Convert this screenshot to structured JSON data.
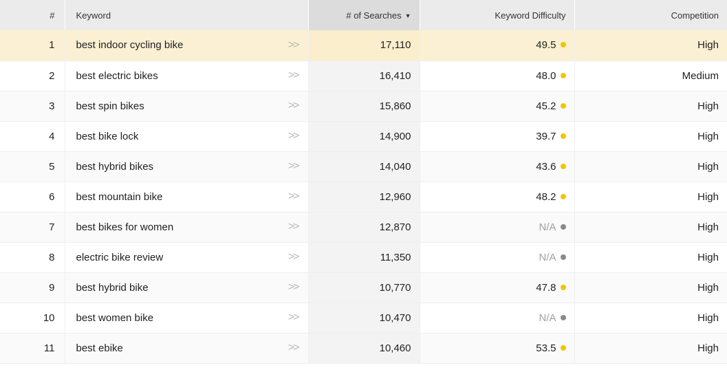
{
  "colors": {
    "difficulty_dot": "#f2c500",
    "na_dot": "#8a8a8a",
    "highlight_row": "#fbf0d3",
    "header_bg": "#ebebeb"
  },
  "header": {
    "num": "#",
    "keyword": "Keyword",
    "searches": "# of Searches",
    "searches_sort_icon": "caret-down-icon",
    "difficulty": "Keyword Difficulty",
    "competition": "Competition"
  },
  "rows": [
    {
      "num": "1",
      "keyword": "best indoor cycling bike",
      "searches": "17,110",
      "difficulty": "49.5",
      "competition": "High"
    },
    {
      "num": "2",
      "keyword": "best electric bikes",
      "searches": "16,410",
      "difficulty": "48.0",
      "competition": "Medium"
    },
    {
      "num": "3",
      "keyword": "best spin bikes",
      "searches": "15,860",
      "difficulty": "45.2",
      "competition": "High"
    },
    {
      "num": "4",
      "keyword": "best bike lock",
      "searches": "14,900",
      "difficulty": "39.7",
      "competition": "High"
    },
    {
      "num": "5",
      "keyword": "best hybrid bikes",
      "searches": "14,040",
      "difficulty": "43.6",
      "competition": "High"
    },
    {
      "num": "6",
      "keyword": "best mountain bike",
      "searches": "12,960",
      "difficulty": "48.2",
      "competition": "High"
    },
    {
      "num": "7",
      "keyword": "best bikes for women",
      "searches": "12,870",
      "difficulty": "N/A",
      "competition": "High"
    },
    {
      "num": "8",
      "keyword": "electric bike review",
      "searches": "11,350",
      "difficulty": "N/A",
      "competition": "High"
    },
    {
      "num": "9",
      "keyword": "best hybrid bike",
      "searches": "10,770",
      "difficulty": "47.8",
      "competition": "High"
    },
    {
      "num": "10",
      "keyword": "best women bike",
      "searches": "10,470",
      "difficulty": "N/A",
      "competition": "High"
    },
    {
      "num": "11",
      "keyword": "best ebike",
      "searches": "10,460",
      "difficulty": "53.5",
      "competition": "High"
    }
  ]
}
